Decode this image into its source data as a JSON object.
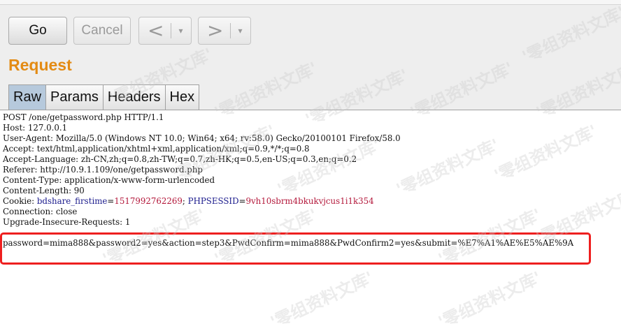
{
  "toolbar": {
    "go_label": "Go",
    "cancel_label": "Cancel",
    "back_arrow": "<",
    "forward_arrow": ">",
    "dropdown_glyph": "▾"
  },
  "section_title": "Request",
  "tabs": [
    {
      "label": "Raw",
      "active": true
    },
    {
      "label": "Params",
      "active": false
    },
    {
      "label": "Headers",
      "active": false
    },
    {
      "label": "Hex",
      "active": false
    }
  ],
  "request": {
    "lines": [
      "POST /one/getpassword.php HTTP/1.1",
      "Host: 127.0.0.1",
      "User-Agent: Mozilla/5.0 (Windows NT 10.0; Win64; x64; rv:58.0) Gecko/20100101 Firefox/58.0",
      "Accept: text/html,application/xhtml+xml,application/xml;q=0.9,*/*;q=0.8",
      "Accept-Language: zh-CN,zh;q=0.8,zh-TW;q=0.7,zh-HK;q=0.5,en-US;q=0.3,en;q=0.2",
      "Referer: http://10.9.1.109/one/getpassword.php",
      "Content-Type: application/x-www-form-urlencoded",
      "Content-Length: 90"
    ],
    "cookie": {
      "prefix": "Cookie: ",
      "name1": "bdshare_firstime",
      "eq": "=",
      "value1": "1517992762269",
      "sep": "; ",
      "name2": "PHPSESSID",
      "value2": "9vh10sbrm4bkukvjcus1i1k354"
    },
    "after_cookie": [
      "Connection: close",
      "Upgrade-Insecure-Requests: 1"
    ],
    "body": "password=mima888&password2=yes&action=step3&PwdConfirm=mima888&PwdConfirm2=yes&submit=%E7%A1%AE%E5%AE%9A"
  },
  "watermark": "'零组资料文库'",
  "colors": {
    "section_title": "#e38b14",
    "active_tab": "#b6c9dc",
    "highlight_border": "#ee1f1f",
    "cookie_name": "#1a1a8c",
    "cookie_value": "#b3173a"
  }
}
